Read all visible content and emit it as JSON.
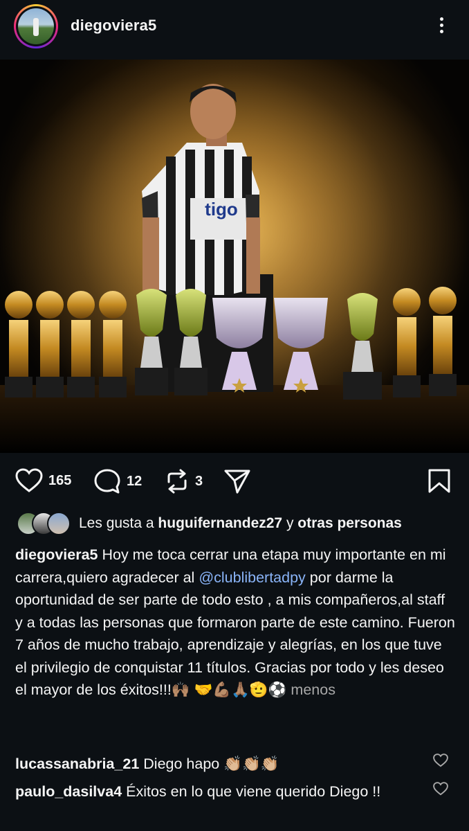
{
  "post": {
    "username": "diegoviera5",
    "shirt_sponsor": "tigo"
  },
  "actions": {
    "likes": "165",
    "comments": "12",
    "reposts": "3"
  },
  "likes_row": {
    "prefix": "Les gusta a ",
    "user": "huguifernandez27",
    "middle": " y ",
    "others": "otras personas"
  },
  "caption": {
    "username": "diegoviera5",
    "text_1": " Hoy me toca cerrar una etapa muy importante en mi carrera,quiero agradecer al ",
    "mention": "@clublibertadpy",
    "text_2": " por darme la oportunidad de ser parte de todo esto , a mis compañeros,al staff y a todas las personas que formaron parte de este camino. Fueron 7 años de mucho trabajo, aprendizaje y alegrías, en los que tuve el privilegio de conquistar 11 títulos. Gracias por todo y les deseo el mayor de los éxitos!!!🙌🏽 🤝💪🏽🙏🏽🫡⚽ ",
    "less": "menos"
  },
  "comments": [
    {
      "user": "lucassanabria_21",
      "text": " Diego hapo 👏🏼👏🏼👏🏼"
    },
    {
      "user": "paulo_dasilva4",
      "text": " Éxitos en lo que viene querido Diego !!"
    }
  ],
  "colors": {
    "background": "#0c1014",
    "mention": "#8ab4f8",
    "muted": "#a8a8a8"
  },
  "icons": [
    "more-vertical-icon",
    "heart-icon",
    "comment-icon",
    "repost-icon",
    "send-icon",
    "bookmark-icon"
  ]
}
